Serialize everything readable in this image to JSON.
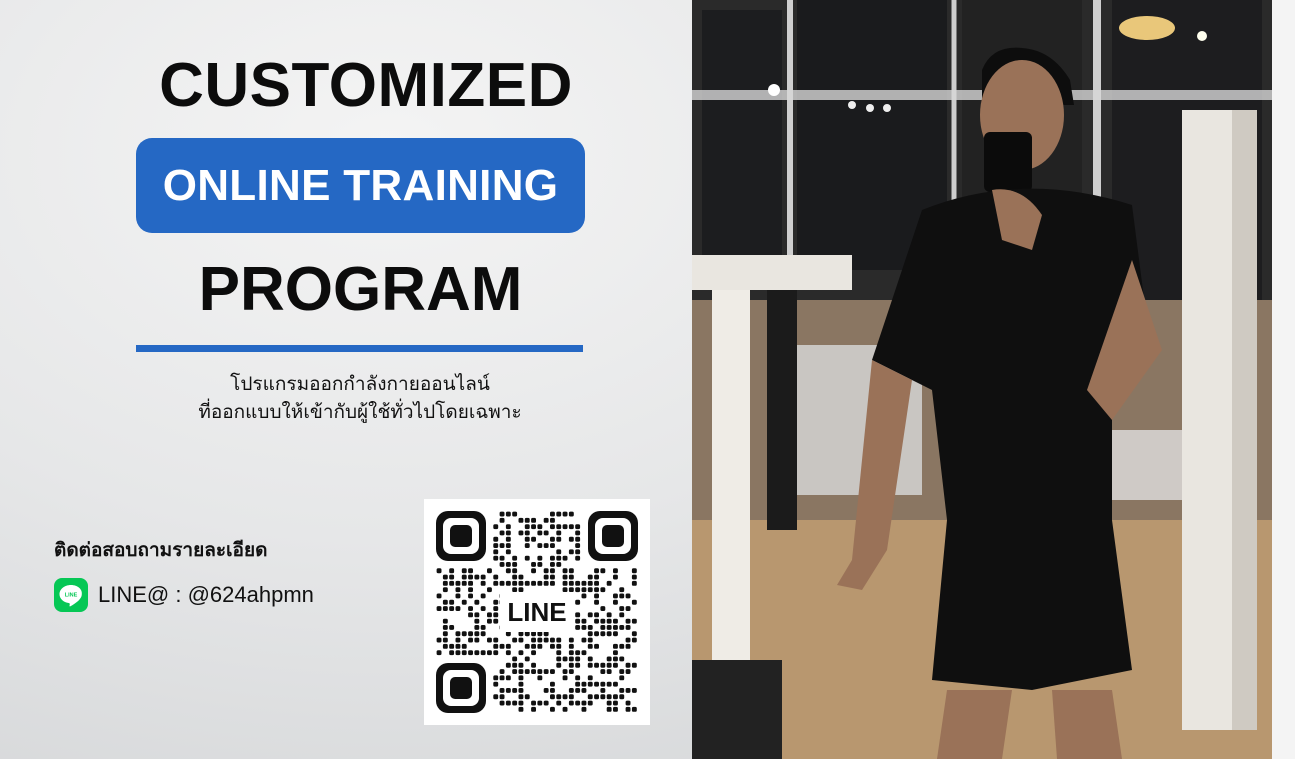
{
  "headline": {
    "line1": "CUSTOMIZED",
    "line2": "ONLINE TRAINING",
    "line3": "PROGRAM"
  },
  "subtitle": {
    "line1": "โปรแกรมออกกำลังกายออนไลน์",
    "line2": "ที่ออกแบบให้เข้ากับผู้ใช้ทั่วไปโดยเฉพาะ"
  },
  "contact": {
    "heading": "ติดต่อสอบถามรายละเอียด",
    "line_label": "LINE@ : @624ahpmn",
    "line_icon": "line-app-icon"
  },
  "qr": {
    "center_label": "LINE"
  },
  "colors": {
    "accent": "#2568c4",
    "line_green": "#06c755"
  }
}
